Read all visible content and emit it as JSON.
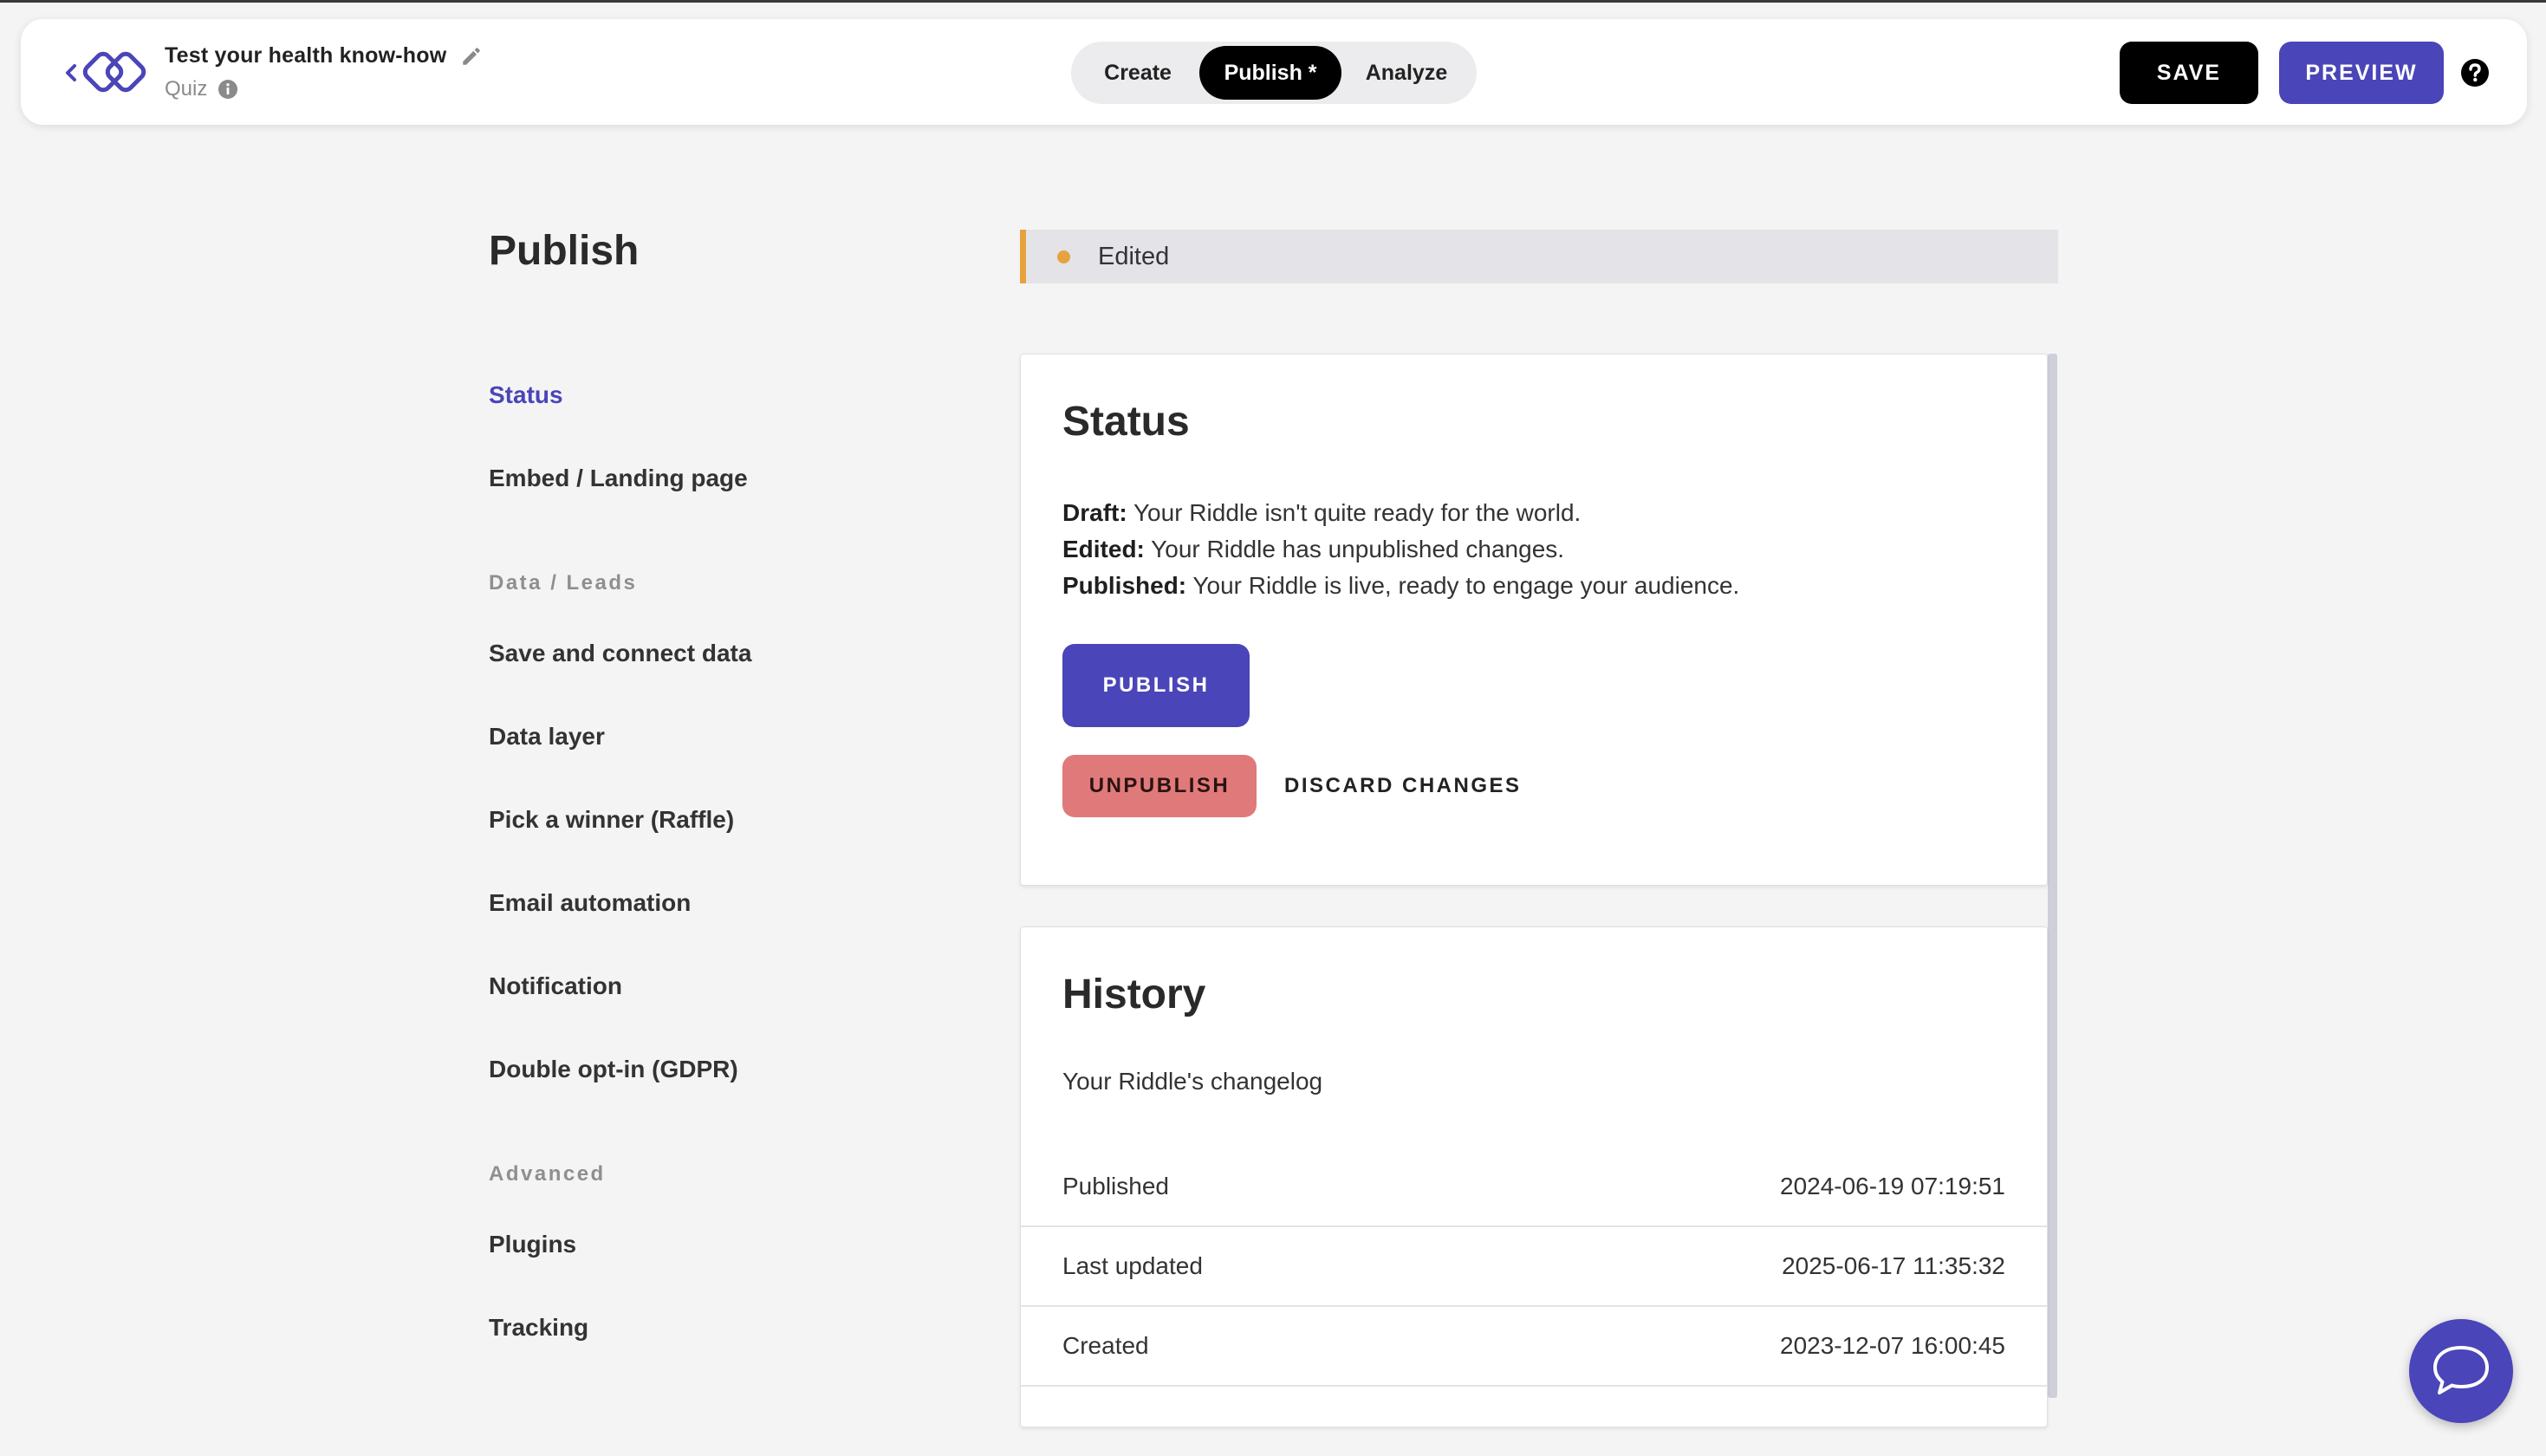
{
  "header": {
    "riddle_title": "Test your health know-how",
    "riddle_type": "Quiz",
    "modes": [
      {
        "label": "Create"
      },
      {
        "label": "Publish *",
        "active": true
      },
      {
        "label": "Analyze"
      }
    ],
    "save_label": "SAVE",
    "preview_label": "PREVIEW"
  },
  "sidebar": {
    "heading": "Publish",
    "items_top": [
      {
        "label": "Status",
        "active": true
      },
      {
        "label": "Embed / Landing page"
      }
    ],
    "section_data": "Data / Leads",
    "items_data": [
      {
        "label": "Save and connect data"
      },
      {
        "label": "Data layer"
      },
      {
        "label": "Pick a winner (Raffle)"
      },
      {
        "label": "Email automation"
      },
      {
        "label": "Notification"
      },
      {
        "label": "Double opt-in (GDPR)"
      }
    ],
    "section_advanced": "Advanced",
    "items_advanced": [
      {
        "label": "Plugins"
      },
      {
        "label": "Tracking"
      }
    ]
  },
  "banner": {
    "text": "Edited",
    "color": "#e6a23c"
  },
  "status_card": {
    "title": "Status",
    "lines": [
      {
        "term": "Draft:",
        "desc": " Your Riddle isn't quite ready for the world."
      },
      {
        "term": "Edited:",
        "desc": " Your Riddle has unpublished changes."
      },
      {
        "term": "Published:",
        "desc": " Your Riddle is live, ready to engage your audience."
      }
    ],
    "publish_label": "PUBLISH",
    "unpublish_label": "UNPUBLISH",
    "discard_label": "DISCARD CHANGES"
  },
  "history_card": {
    "title": "History",
    "subtitle": "Your Riddle's changelog",
    "rows": [
      {
        "label": "Published",
        "value": "2024-06-19 07:19:51"
      },
      {
        "label": "Last updated",
        "value": "2025-06-17 11:35:32"
      },
      {
        "label": "Created",
        "value": "2023-12-07 16:00:45"
      }
    ]
  },
  "colors": {
    "accent": "#4a45b8",
    "danger": "#e07a7a",
    "edited": "#e6a23c"
  }
}
